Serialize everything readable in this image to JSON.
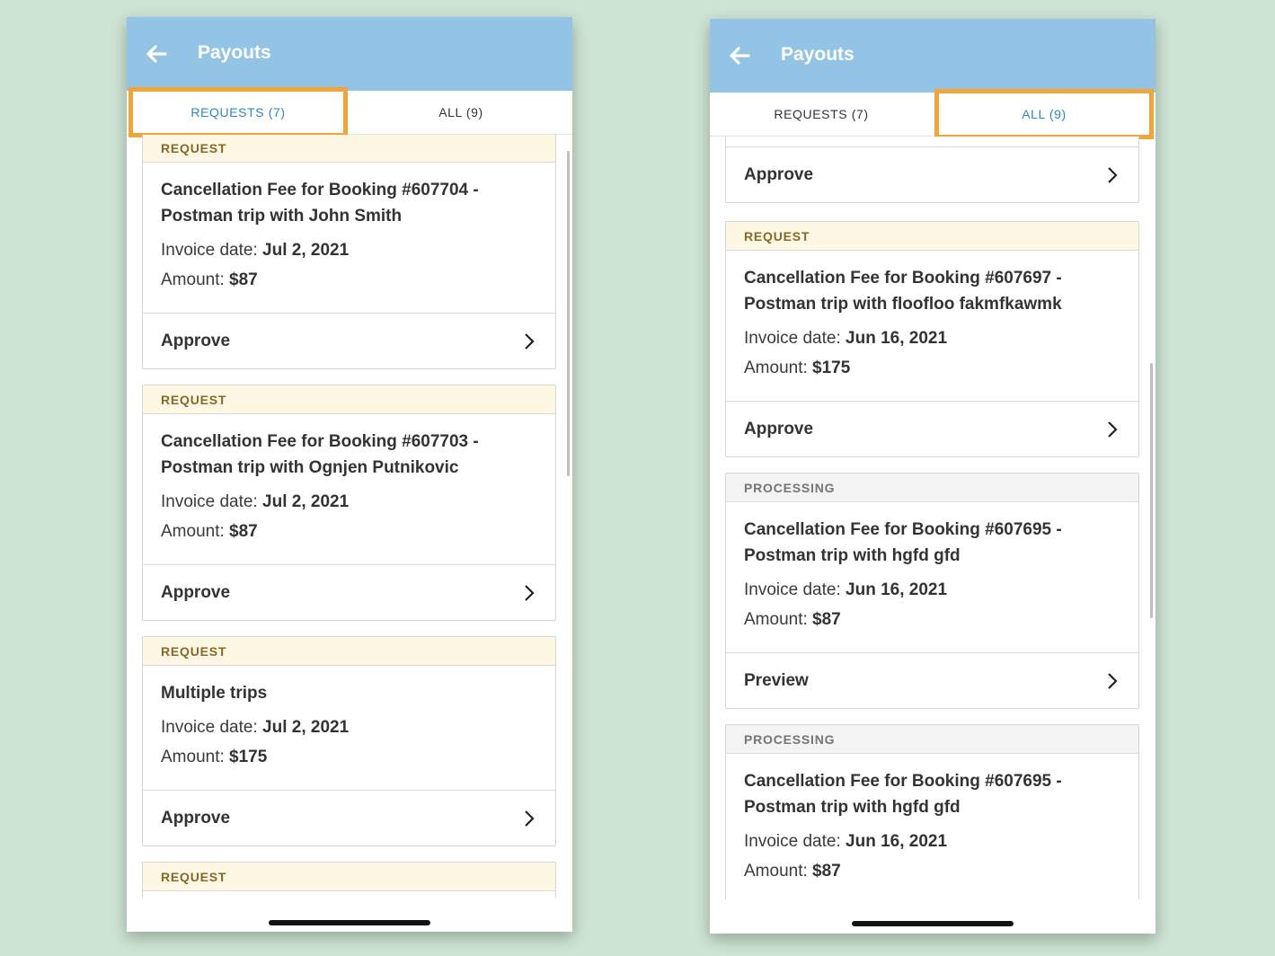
{
  "screens": [
    {
      "header": {
        "title": "Payouts",
        "back_icon": "arrow-left-icon"
      },
      "tabs": [
        {
          "label": "REQUESTS (7)"
        },
        {
          "label": "ALL (9)"
        }
      ],
      "cards": [
        {
          "status": "REQUEST",
          "title_line1": "Cancellation Fee for Booking #607704 -",
          "title_line2": "Postman trip  with John Smith",
          "invoice_label": "Invoice date:",
          "invoice_value": "Jul 2, 2021",
          "amount_label": "Amount:",
          "amount_value": "$87",
          "action": "Approve"
        },
        {
          "status": "REQUEST",
          "title_line1": "Cancellation Fee for Booking #607703 -",
          "title_line2": "Postman trip  with Ognjen Putnikovic",
          "invoice_label": "Invoice date:",
          "invoice_value": "Jul 2, 2021",
          "amount_label": "Amount:",
          "amount_value": "$87",
          "action": "Approve"
        },
        {
          "status": "REQUEST",
          "title_line1": "Multiple trips",
          "invoice_label": "Invoice date:",
          "invoice_value": "Jul 2, 2021",
          "amount_label": "Amount:",
          "amount_value": "$175",
          "action": "Approve"
        },
        {
          "status": "REQUEST"
        }
      ]
    },
    {
      "header": {
        "title": "Payouts",
        "back_icon": "arrow-left-icon"
      },
      "tabs": [
        {
          "label": "REQUESTS (7)"
        },
        {
          "label": "ALL (9)"
        }
      ],
      "cards": [
        {
          "action": "Approve"
        },
        {
          "status": "REQUEST",
          "title_line1": "Cancellation Fee for Booking #607697 -",
          "title_line2": "Postman trip  with floofloo fakmfkawmk",
          "invoice_label": "Invoice date:",
          "invoice_value": "Jun 16, 2021",
          "amount_label": "Amount:",
          "amount_value": "$175",
          "action": "Approve"
        },
        {
          "status": "PROCESSING",
          "title_line1": "Cancellation Fee for Booking #607695 -",
          "title_line2": "Postman trip  with hgfd gfd",
          "invoice_label": "Invoice date:",
          "invoice_value": "Jun 16, 2021",
          "amount_label": "Amount:",
          "amount_value": "$87",
          "action": "Preview"
        },
        {
          "status": "PROCESSING",
          "title_line1": "Cancellation Fee for Booking #607695 -",
          "title_line2": "Postman trip  with hgfd gfd",
          "invoice_label": "Invoice date:",
          "invoice_value": "Jun 16, 2021",
          "amount_label": "Amount:",
          "amount_value": "$87"
        }
      ]
    }
  ],
  "colors": {
    "background": "#cde3d3",
    "appbar": "#93c3e5",
    "highlight": "#f0a43a",
    "active_tab": "#2f86c1",
    "request_badge_bg": "#fdf7e3",
    "request_badge_text": "#86682b",
    "processing_badge_bg": "#f3f3f3"
  }
}
